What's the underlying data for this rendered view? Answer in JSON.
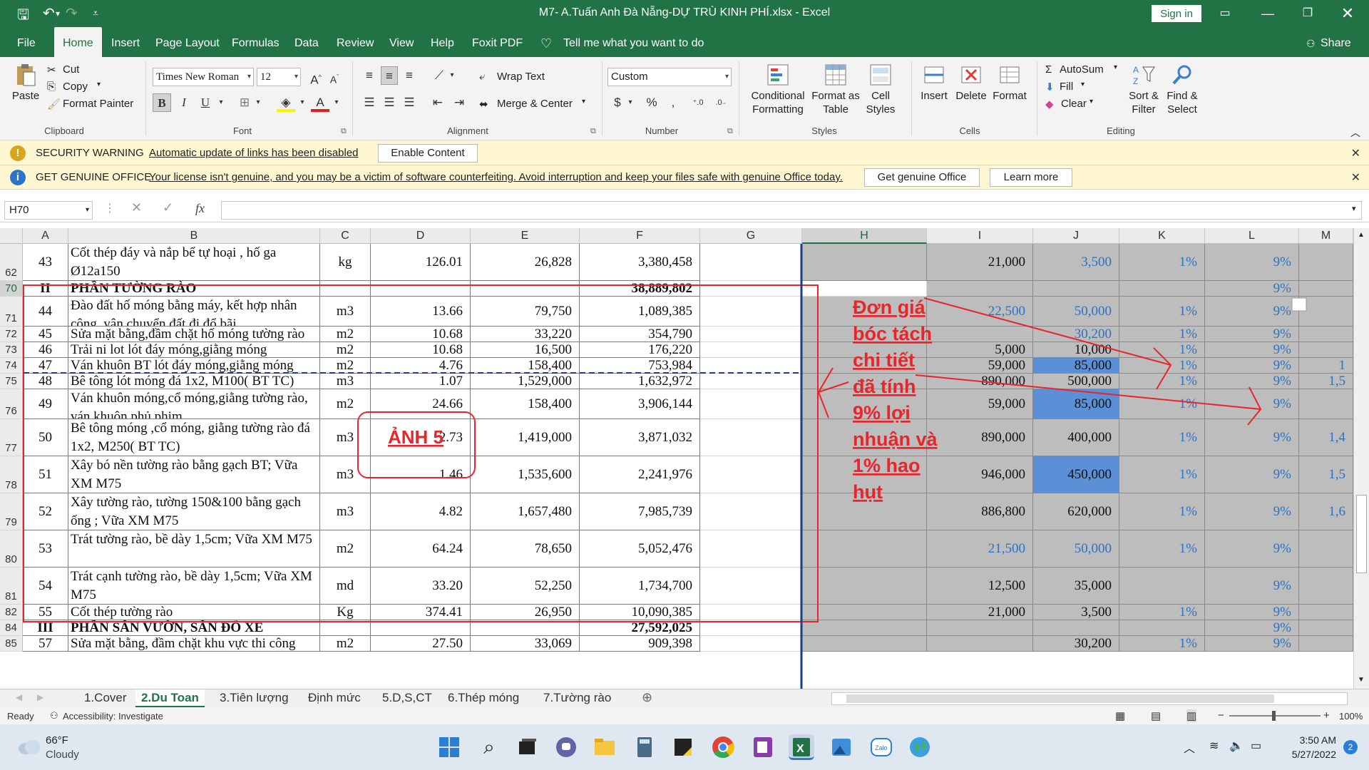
{
  "title_bar": {
    "doc_title": "M7- A.Tuấn Anh Đà Nẵng-DỰ TRÙ KINH PHÍ.xlsx  -  Excel",
    "sign_in": "Sign in"
  },
  "menu": {
    "tabs": [
      "File",
      "Home",
      "Insert",
      "Page Layout",
      "Formulas",
      "Data",
      "Review",
      "View",
      "Help",
      "Foxit PDF"
    ],
    "tell": "Tell me what you want to do",
    "share": "Share"
  },
  "ribbon": {
    "clipboard": {
      "paste": "Paste",
      "cut": "Cut",
      "copy": "Copy",
      "format_painter": "Format Painter",
      "label": "Clipboard"
    },
    "font": {
      "name": "Times New Roman",
      "size": "12",
      "label": "Font",
      "bold": "B",
      "italic": "I",
      "underline": "U"
    },
    "alignment": {
      "wrap": "Wrap Text",
      "merge": "Merge & Center",
      "label": "Alignment"
    },
    "number": {
      "format": "Custom",
      "label": "Number"
    },
    "styles": {
      "conditional": "Conditional Formatting",
      "format_table": "Format as Table",
      "cell_styles": "Cell Styles",
      "label": "Styles"
    },
    "cells": {
      "insert": "Insert",
      "delete": "Delete",
      "format": "Format",
      "label": "Cells"
    },
    "editing": {
      "autosum": "AutoSum",
      "fill": "Fill",
      "clear": "Clear",
      "sort": "Sort & Filter",
      "find": "Find & Select",
      "label": "Editing"
    }
  },
  "security_bar": {
    "head": "SECURITY WARNING",
    "message": "Automatic update of links has been disabled",
    "button": "Enable Content"
  },
  "genuine_bar": {
    "head": "GET GENUINE OFFICE",
    "message": "Your license isn't genuine, and you may be a victim of software counterfeiting. Avoid interruption and keep your files safe with genuine Office today.",
    "button1": "Get genuine Office",
    "button2": "Learn more"
  },
  "formula_bar": {
    "name_box": "H70",
    "fx": "fx"
  },
  "columns": [
    "A",
    "B",
    "C",
    "D",
    "E",
    "F",
    "G",
    "H",
    "I",
    "J",
    "K",
    "L",
    "M"
  ],
  "rows": [
    {
      "rn": "62",
      "A": "43",
      "B": "Cốt thép đáy và nắp bể tự hoại , hố ga Ø12a150",
      "C": "kg",
      "D": "126.01",
      "E": "26,828",
      "F": "3,380,458",
      "I": "21,000",
      "J": "3,500",
      "K": "1%",
      "L": "9%"
    },
    {
      "rn": "70",
      "A": "II",
      "B": "PHẦN TƯỜNG RÀO",
      "C": "",
      "D": "",
      "E": "",
      "F": "38,889,802",
      "I": "",
      "J": "",
      "K": "",
      "L": "9%"
    },
    {
      "rn": "71",
      "A": "44",
      "B": "Đào đất hố móng bằng máy, kết hợp nhân công, vận chuyển đất đi đổ bãi",
      "C": "m3",
      "D": "13.66",
      "E": "79,750",
      "F": "1,089,385",
      "I": "22,500",
      "J": "50,000",
      "K": "1%",
      "L": "9%"
    },
    {
      "rn": "72",
      "A": "45",
      "B": "Sửa mặt bằng,đầm chặt hố móng tường rào",
      "C": "m2",
      "D": "10.68",
      "E": "33,220",
      "F": "354,790",
      "I": "",
      "J": "30,200",
      "K": "1%",
      "L": "9%"
    },
    {
      "rn": "73",
      "A": "46",
      "B": "Trải ni lot lót đáy móng,giằng móng",
      "C": "m2",
      "D": "10.68",
      "E": "16,500",
      "F": "176,220",
      "I": "5,000",
      "J": "10,000",
      "K": "1%",
      "L": "9%"
    },
    {
      "rn": "74",
      "A": "47",
      "B": "Ván khuôn BT lót đáy móng,giằng móng",
      "C": "m2",
      "D": "4.76",
      "E": "158,400",
      "F": "753,984",
      "I": "59,000",
      "J": "85,000",
      "K": "1%",
      "L": "9%"
    },
    {
      "rn": "75",
      "A": "48",
      "B": "Bê tông lót móng đá 1x2, M100( BT TC)",
      "C": "m3",
      "D": "1.07",
      "E": "1,529,000",
      "F": "1,632,972",
      "I": "890,000",
      "J": "500,000",
      "K": "1%",
      "L": "9%"
    },
    {
      "rn": "76",
      "A": "49",
      "B": "Ván khuôn móng,cổ móng,giằng tường rào, ván khuôn phủ phim",
      "C": "m2",
      "D": "24.66",
      "E": "158,400",
      "F": "3,906,144",
      "I": "59,000",
      "J": "85,000",
      "K": "1%",
      "L": "9%"
    },
    {
      "rn": "77",
      "A": "50",
      "B": "Bê tông móng ,cổ móng, giằng tường rào đá 1x2, M250( BT TC)",
      "C": "m3",
      "D": "2.73",
      "E": "1,419,000",
      "F": "3,871,032",
      "I": "890,000",
      "J": "400,000",
      "K": "1%",
      "L": "9%"
    },
    {
      "rn": "78",
      "A": "51",
      "B": "Xây bó nền tường rào bằng gạch BT; Vữa XM M75",
      "C": "m3",
      "D": "1.46",
      "E": "1,535,600",
      "F": "2,241,976",
      "I": "946,000",
      "J": "450,000",
      "K": "1%",
      "L": "9%"
    },
    {
      "rn": "79",
      "A": "52",
      "B": "Xây tường rào, tường 150&100 bằng gạch ống ; Vữa XM M75",
      "C": "m3",
      "D": "4.82",
      "E": "1,657,480",
      "F": "7,985,739",
      "I": "886,800",
      "J": "620,000",
      "K": "1%",
      "L": "9%"
    },
    {
      "rn": "80",
      "A": "53",
      "B": "Trát tường rào, bề dày 1,5cm; Vữa XM M75",
      "C": "m2",
      "D": "64.24",
      "E": "78,650",
      "F": "5,052,476",
      "I": "21,500",
      "J": "50,000",
      "K": "1%",
      "L": "9%"
    },
    {
      "rn": "81",
      "A": "54",
      "B": "Trát cạnh tường rào, bề dày 1,5cm; Vữa XM M75",
      "C": "md",
      "D": "33.20",
      "E": "52,250",
      "F": "1,734,700",
      "I": "12,500",
      "J": "35,000",
      "K": "",
      "L": "9%"
    },
    {
      "rn": "82",
      "A": "55",
      "B": "Cốt thép tường rào",
      "C": "Kg",
      "D": "374.41",
      "E": "26,950",
      "F": "10,090,385",
      "I": "21,000",
      "J": "3,500",
      "K": "1%",
      "L": "9%"
    },
    {
      "rn": "84",
      "A": "III",
      "B": "PHẦN SÂN VƯỜN, SÂN ĐỖ XE",
      "C": "",
      "D": "",
      "E": "",
      "F": "27,592,025",
      "I": "",
      "J": "",
      "K": "",
      "L": "9%"
    },
    {
      "rn": "85",
      "A": "57",
      "B": "Sửa mặt bằng, đầm chặt khu vực thi công",
      "C": "m2",
      "D": "27.50",
      "E": "33,069",
      "F": "909,398",
      "I": "",
      "J": "30,200",
      "K": "1%",
      "L": "9%"
    }
  ],
  "col_m_partial": [
    "",
    "",
    "",
    "",
    "",
    "1",
    "1,5",
    "",
    "1,4",
    "1,5",
    "1,6",
    "",
    "",
    "",
    "",
    ""
  ],
  "annotations": {
    "anh5": "ẢNH 5",
    "note_lines": [
      "Đơn giá",
      "bóc tách",
      "chi tiết",
      "đã tính",
      "9% lợi",
      "nhuận và",
      "1% hao",
      "hụt"
    ],
    "color": "#e8252b"
  },
  "sheet_tabs": [
    "1.Cover",
    "2.Du Toan",
    "3.Tiên lượng",
    "Định mức",
    "5.D,S,CT",
    "6.Thép móng",
    "7.Tường rào"
  ],
  "status": {
    "ready": "Ready",
    "accessibility": "Accessibility: Investigate",
    "zoom": "100%"
  },
  "taskbar": {
    "temp": "66°F",
    "weather": "Cloudy",
    "time": "3:50 AM",
    "date": "5/27/2022",
    "badge": "2"
  }
}
